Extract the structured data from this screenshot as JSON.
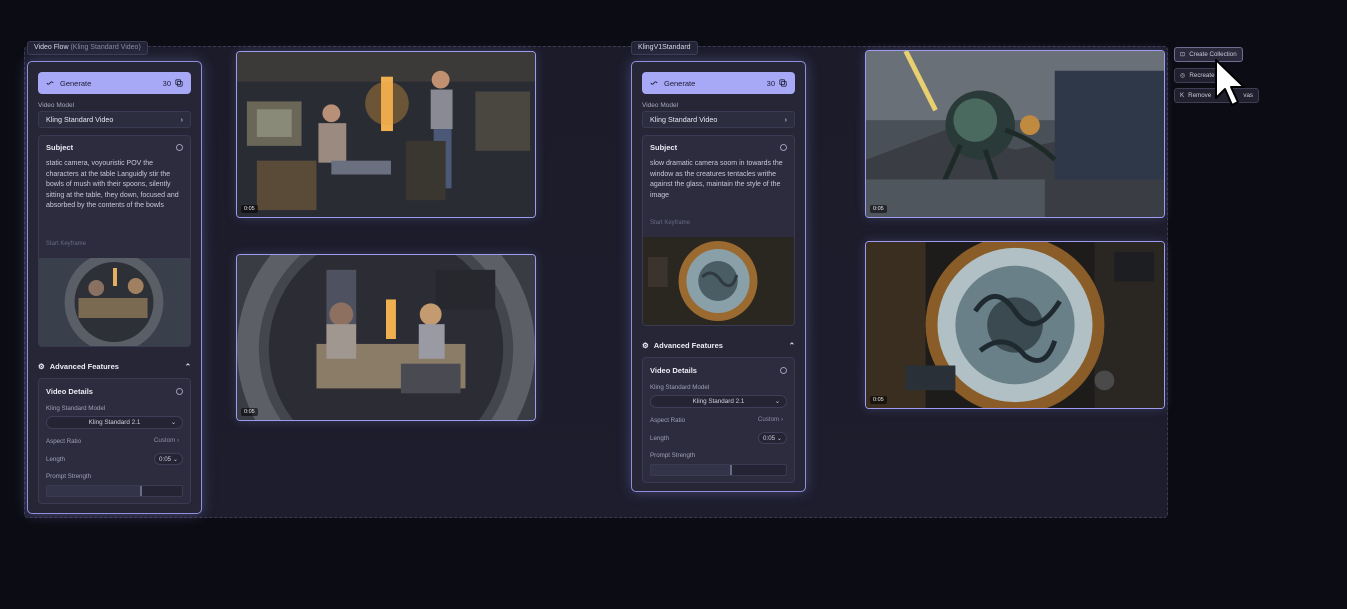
{
  "groups": [
    {
      "tag_main": "Video Flow",
      "tag_sub": "(Kling Standard Video)",
      "panel": {
        "generate_label": "Generate",
        "credits": "30",
        "video_model_label": "Video Model",
        "video_model_value": "Kling Standard Video",
        "subject_title": "Subject",
        "prompt": "static camera, voyouristic POV the characters at the table Languidly stir the bowls of mush with their spoons, silently sitting at the table, they down, focused and absorbed by the contents of the bowls",
        "start_keyframe_label": "Start Keyframe",
        "advanced_features_label": "Advanced Features",
        "video_details_title": "Video Details",
        "model_label": "Kling Standard Model",
        "model_value": "Kling Standard 2.1",
        "aspect_ratio_label": "Aspect Ratio",
        "aspect_ratio_value": "Custom",
        "length_label": "Length",
        "length_value": "0:05",
        "prompt_strength_label": "Prompt Strength",
        "prompt_strength_level": 0.7
      },
      "videos": [
        {
          "duration": "0:05",
          "scene": "two people in a cluttered retro-tech room"
        },
        {
          "duration": "0:05",
          "scene": "couple eating at a table inside a porthole room"
        }
      ]
    },
    {
      "tag_main": "KlingV1Standard",
      "tag_sub": "",
      "panel": {
        "generate_label": "Generate",
        "credits": "30",
        "video_model_label": "Video Model",
        "video_model_value": "Kling Standard Video",
        "subject_title": "Subject",
        "prompt": "slow dramatic camera soom in towards the window as the creatures tentacles writhe against the glass, maintain the style of the image",
        "start_keyframe_label": "Start Keyframe",
        "advanced_features_label": "Advanced Features",
        "video_details_title": "Video Details",
        "model_label": "Kling Standard Model",
        "model_value": "Kling Standard 2.1",
        "aspect_ratio_label": "Aspect Ratio",
        "aspect_ratio_value": "Custom",
        "length_label": "Length",
        "length_value": "0:05",
        "prompt_strength_label": "Prompt Strength",
        "prompt_strength_level": 0.6
      },
      "videos": [
        {
          "duration": "0:05",
          "scene": "tentacled creature attacking a train in a storm"
        },
        {
          "duration": "0:05",
          "scene": "tentacled creature behind a round porthole window"
        }
      ]
    }
  ],
  "context_menu": {
    "create_collection": "Create Collection",
    "recreate": "Recreate",
    "remove": "Remove",
    "remove_suffix": "vas"
  },
  "colors": {
    "accent": "#a7a8f6",
    "panel_border": "#8f8ee0",
    "background": "#0c0c14"
  }
}
